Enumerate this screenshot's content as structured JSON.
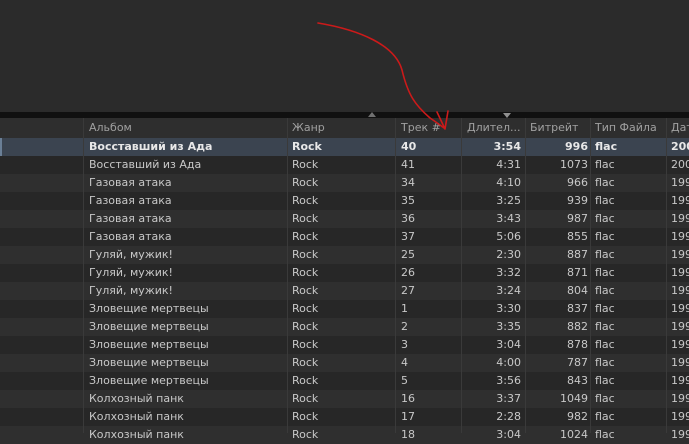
{
  "columns": {
    "album": "Альбом",
    "genre": "Жанр",
    "track": "Трек #",
    "duration": "Длител...",
    "bitrate": "Битрейт",
    "filetype": "Тип Файла",
    "date": "Дат"
  },
  "rows": [
    {
      "album": "Восставший из Ада",
      "genre": "Rock",
      "track": "40",
      "duration": "3:54",
      "bitrate": "996",
      "filetype": "flac",
      "date": "200",
      "selected": true
    },
    {
      "album": "Восставший из Ада",
      "genre": "Rock",
      "track": "41",
      "duration": "4:31",
      "bitrate": "1073",
      "filetype": "flac",
      "date": "200"
    },
    {
      "album": "Газовая атака",
      "genre": "Rock",
      "track": "34",
      "duration": "4:10",
      "bitrate": "966",
      "filetype": "flac",
      "date": "199"
    },
    {
      "album": "Газовая атака",
      "genre": "Rock",
      "track": "35",
      "duration": "3:25",
      "bitrate": "939",
      "filetype": "flac",
      "date": "199"
    },
    {
      "album": "Газовая атака",
      "genre": "Rock",
      "track": "36",
      "duration": "3:43",
      "bitrate": "987",
      "filetype": "flac",
      "date": "199"
    },
    {
      "album": "Газовая атака",
      "genre": "Rock",
      "track": "37",
      "duration": "5:06",
      "bitrate": "855",
      "filetype": "flac",
      "date": "199"
    },
    {
      "album": "Гуляй, мужик!",
      "genre": "Rock",
      "track": "25",
      "duration": "2:30",
      "bitrate": "887",
      "filetype": "flac",
      "date": "199"
    },
    {
      "album": "Гуляй, мужик!",
      "genre": "Rock",
      "track": "26",
      "duration": "3:32",
      "bitrate": "871",
      "filetype": "flac",
      "date": "199"
    },
    {
      "album": "Гуляй, мужик!",
      "genre": "Rock",
      "track": "27",
      "duration": "3:24",
      "bitrate": "804",
      "filetype": "flac",
      "date": "199"
    },
    {
      "album": "Зловещие мертвецы",
      "genre": "Rock",
      "track": "1",
      "duration": "3:30",
      "bitrate": "837",
      "filetype": "flac",
      "date": "199"
    },
    {
      "album": "Зловещие мертвецы",
      "genre": "Rock",
      "track": "2",
      "duration": "3:35",
      "bitrate": "882",
      "filetype": "flac",
      "date": "199"
    },
    {
      "album": "Зловещие мертвецы",
      "genre": "Rock",
      "track": "3",
      "duration": "3:04",
      "bitrate": "878",
      "filetype": "flac",
      "date": "199"
    },
    {
      "album": "Зловещие мертвецы",
      "genre": "Rock",
      "track": "4",
      "duration": "4:00",
      "bitrate": "787",
      "filetype": "flac",
      "date": "199"
    },
    {
      "album": "Зловещие мертвецы",
      "genre": "Rock",
      "track": "5",
      "duration": "3:56",
      "bitrate": "843",
      "filetype": "flac",
      "date": "199"
    },
    {
      "album": "Колхозный панк",
      "genre": "Rock",
      "track": "16",
      "duration": "3:37",
      "bitrate": "1049",
      "filetype": "flac",
      "date": "199"
    },
    {
      "album": "Колхозный панк",
      "genre": "Rock",
      "track": "17",
      "duration": "2:28",
      "bitrate": "982",
      "filetype": "flac",
      "date": "199"
    },
    {
      "album": "Колхозный панк",
      "genre": "Rock",
      "track": "18",
      "duration": "3:04",
      "bitrate": "1024",
      "filetype": "flac",
      "date": "199"
    }
  ],
  "colors": {
    "annotation_arrow": "#cc1a1a",
    "selected_row": "#3b4450"
  }
}
